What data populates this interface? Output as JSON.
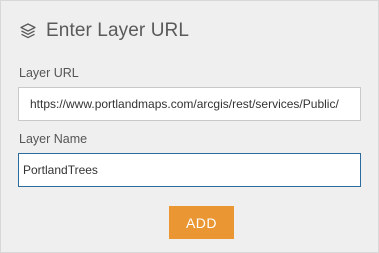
{
  "dialog": {
    "title": "Enter Layer URL",
    "icon": "layers-icon"
  },
  "fields": {
    "url": {
      "label": "Layer URL",
      "value": "https://www.portlandmaps.com/arcgis/rest/services/Public/"
    },
    "name": {
      "label": "Layer Name",
      "value": "PortlandTrees"
    }
  },
  "actions": {
    "add_label": "ADD"
  },
  "colors": {
    "panel_background": "#efefef",
    "accent_button": "#ea9632",
    "focused_border": "#2b6c9e"
  }
}
